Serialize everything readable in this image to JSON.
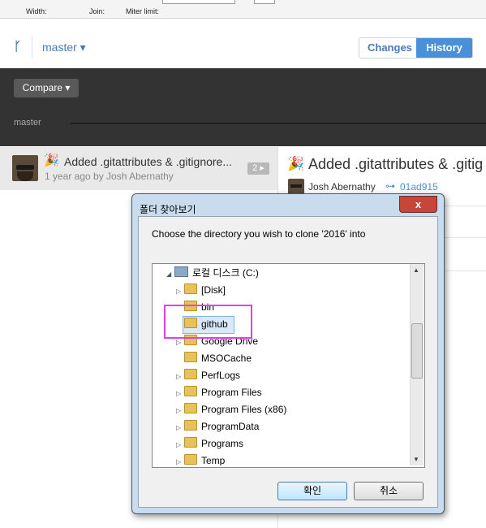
{
  "toolbar": {
    "width_label": "Width:",
    "join_label": "Join:",
    "miter_label": "Miter limit:"
  },
  "header": {
    "branch": "master ▾",
    "branch_icon": "git-branch-icon"
  },
  "segmented": {
    "changes": "Changes",
    "history": "History",
    "active": "History"
  },
  "compare": {
    "label": "Compare ▾"
  },
  "timeline": {
    "branch_label": "master"
  },
  "commit_list": [
    {
      "emoji": "🎉",
      "title": "Added .gitattributes & .gitignore...",
      "meta": "1 year ago by Josh Abernathy",
      "badge": "2 ▸"
    }
  ],
  "detail": {
    "emoji": "🎉",
    "title": "Added .gitattributes & .gitig",
    "author": "Josh Abernathy",
    "sha_icon": "⊶",
    "sha": "01ad915"
  },
  "dialog": {
    "title": "폴더 찾아보기",
    "close": "x",
    "message": "Choose the directory you wish to clone '2016' into",
    "ok": "확인",
    "cancel": "취소",
    "tree": [
      {
        "label": "로컬 디스크 (C:)",
        "icon": "drive-icon",
        "expander": "◢"
      },
      {
        "label": "[Disk]",
        "icon": "folder-icon",
        "expander": "▷"
      },
      {
        "label": "bin",
        "icon": "folder-icon",
        "expander": ""
      },
      {
        "label": "github",
        "icon": "folder-icon",
        "expander": "",
        "selected": true
      },
      {
        "label": "Google Drive",
        "icon": "folder-icon",
        "expander": "▷"
      },
      {
        "label": "MSOCache",
        "icon": "folder-icon",
        "expander": ""
      },
      {
        "label": "PerfLogs",
        "icon": "folder-icon",
        "expander": "▷"
      },
      {
        "label": "Program Files",
        "icon": "folder-icon",
        "expander": "▷"
      },
      {
        "label": "Program Files (x86)",
        "icon": "folder-icon",
        "expander": "▷"
      },
      {
        "label": "ProgramData",
        "icon": "folder-icon",
        "expander": "▷"
      },
      {
        "label": "Programs",
        "icon": "folder-icon",
        "expander": "▷"
      },
      {
        "label": "Temp",
        "icon": "folder-icon",
        "expander": "▷"
      }
    ]
  },
  "colors": {
    "accent": "#4a90d9",
    "highlight": "#e43fe6",
    "dark_bar": "#333333"
  }
}
